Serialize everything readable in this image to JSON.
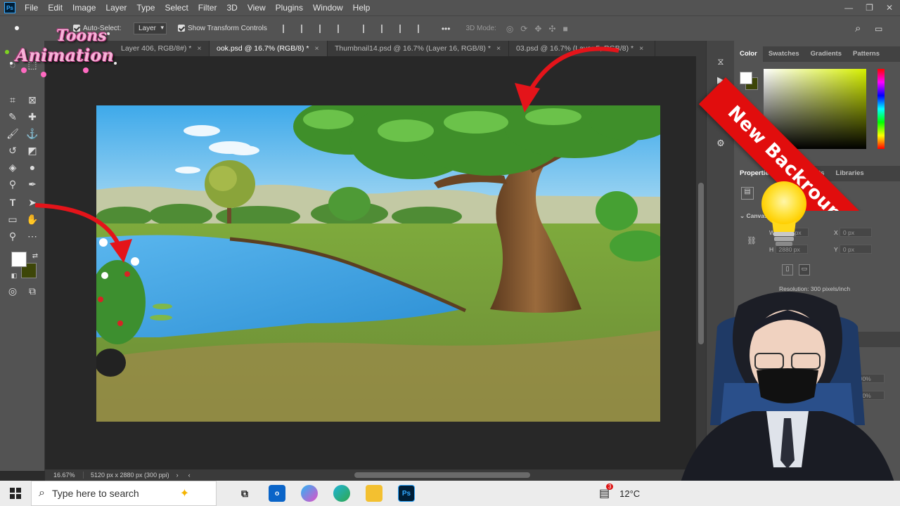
{
  "menubar": {
    "app_icon": "Ps",
    "items": [
      "File",
      "Edit",
      "Image",
      "Layer",
      "Type",
      "Select",
      "Filter",
      "3D",
      "View",
      "Plugins",
      "Window",
      "Help"
    ]
  },
  "options": {
    "auto_select_label": "Auto-Select:",
    "auto_select_value": "Layer",
    "transform_controls_label": "Show Transform Controls",
    "mode_label": "3D Mode:",
    "more": "•••"
  },
  "tabs": [
    {
      "label": "Layer 406, RGB/8#) *",
      "active": false
    },
    {
      "label": "ook.psd @ 16.7% (RGB/8) *",
      "active": true
    },
    {
      "label": "Thumbnail14.psd @ 16.7% (Layer 16, RGB/8) *",
      "active": false
    },
    {
      "label": "03.psd @ 16.7% (Layer 5, RGB/8) *",
      "active": false
    }
  ],
  "tab_close": "×",
  "statusbar": {
    "zoom": "16.67%",
    "doc_info": "5120 px x 2880 px (300 ppi)"
  },
  "color_panel": {
    "tabs": [
      "Color",
      "Swatches",
      "Gradients",
      "Patterns"
    ],
    "fg_color": "#ffffff",
    "bg_color": "#3d4608"
  },
  "properties_panel": {
    "tabs": [
      "Properties",
      "Adjustments",
      "Libraries"
    ],
    "section": "Canvas",
    "w_label": "W",
    "w_value": "5120 px",
    "h_label": "H",
    "h_value": "2880 px",
    "x_label": "X",
    "x_value": "0 px",
    "y_label": "Y",
    "y_value": "0 px",
    "resolution": "Resolution: 300 pixels/inch"
  },
  "layers_panel": {
    "opacity": "100%",
    "fill": "100%"
  },
  "overlay": {
    "logo_line1": "Toons",
    "logo_line2": "Animation",
    "banner": "New Backround Create"
  },
  "taskbar": {
    "search_placeholder": "Type here to search",
    "weather": "12°C",
    "notification_count": "3",
    "apps": [
      "task-view",
      "outlook",
      "copilot",
      "edge",
      "file-explorer",
      "photoshop"
    ]
  }
}
